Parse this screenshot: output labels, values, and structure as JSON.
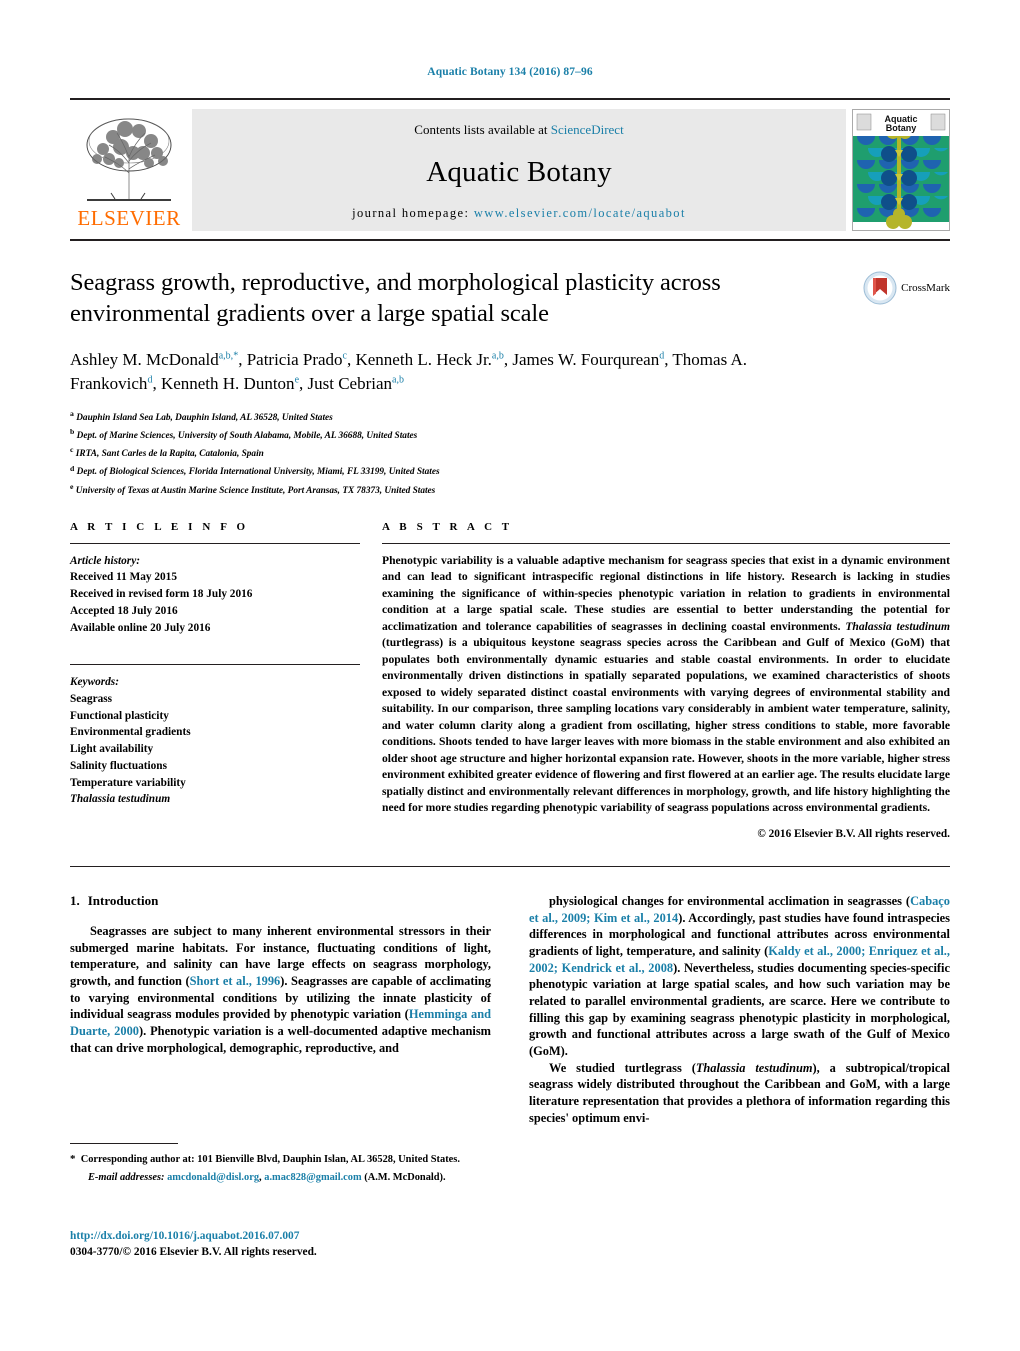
{
  "running_head": "Aquatic Botany 134 (2016) 87–96",
  "masthead": {
    "publisher": "ELSEVIER",
    "contents_prefix": "Contents lists available at ",
    "contents_link": "ScienceDirect",
    "journal_name": "Aquatic Botany",
    "homepage_prefix": "journal homepage: ",
    "homepage_url": "www.elsevier.com/locate/aquabot",
    "cover_title_line1": "Aquatic",
    "cover_title_line2": "Botany",
    "accent_color": "#1a7fa8",
    "elsevier_orange": "#ff6c00"
  },
  "crossmark": {
    "label": "CrossMark"
  },
  "title": "Seagrass growth, reproductive, and morphological plasticity across environmental gradients over a large spatial scale",
  "authors_html": "Ashley M. McDonald<sup>a,b,</sup><sup>*</sup>, Patricia Prado<sup>c</sup>, Kenneth L. Heck Jr.<sup>a,b</sup>, James W. Fourqurean<sup>d</sup>, Thomas A. Frankovich<sup>d</sup>, Kenneth H. Dunton<sup>e</sup>, Just Cebrian<sup>a,b</sup>",
  "affiliations": [
    {
      "mark": "a",
      "text": "Dauphin Island Sea Lab, Dauphin Island, AL 36528, United States"
    },
    {
      "mark": "b",
      "text": "Dept. of Marine Sciences, University of South Alabama, Mobile, AL 36688, United States"
    },
    {
      "mark": "c",
      "text": "IRTA, Sant Carles de la Rapita, Catalonia, Spain"
    },
    {
      "mark": "d",
      "text": "Dept. of Biological Sciences, Florida International University, Miami, FL 33199, United States"
    },
    {
      "mark": "e",
      "text": "University of Texas at Austin Marine Science Institute, Port Aransas, TX 78373, United States"
    }
  ],
  "article_info": {
    "heading": "A R T I C L E   I N F O",
    "history_label": "Article history:",
    "history": [
      "Received 11 May 2015",
      "Received in revised form 18 July 2016",
      "Accepted 18 July 2016",
      "Available online 20 July 2016"
    ],
    "keywords_label": "Keywords:",
    "keywords": [
      "Seagrass",
      "Functional plasticity",
      "Environmental gradients",
      "Light availability",
      "Salinity fluctuations",
      "Temperature variability",
      "Thalassia testudinum"
    ],
    "keywords_italic_index": 6
  },
  "abstract": {
    "heading": "A B S T R A C T",
    "paragraph_html": "Phenotypic variability is a valuable adaptive mechanism for seagrass species that exist in a dynamic environment and can lead to significant intraspecific regional distinctions in life history. Research is lacking in studies examining the significance of within-species phenotypic variation in relation to gradients in environmental condition at a large spatial scale. These studies are essential to better understanding the potential for acclimatization and tolerance capabilities of seagrasses in declining coastal environments. <span class=\"ital\">Thalassia testudinum</span> (turtlegrass) is a ubiquitous keystone seagrass species across the Caribbean and Gulf of Mexico (GoM) that populates both environmentally dynamic estuaries and stable coastal environments. In order to elucidate environmentally driven distinctions in spatially separated populations, we examined characteristics of shoots exposed to widely separated distinct coastal environments with varying degrees of environmental stability and suitability. In our comparison, three sampling locations vary considerably in ambient water temperature, salinity, and water column clarity along a gradient from oscillating, higher stress conditions to stable, more favorable conditions. Shoots tended to have larger leaves with more biomass in the stable environment and also exhibited an older shoot age structure and higher horizontal expansion rate. However, shoots in the more variable, higher stress environment exhibited greater evidence of flowering and first flowered at an earlier age. The results elucidate large spatially distinct and environmentally relevant differences in morphology, growth, and life history highlighting the need for more studies regarding phenotypic variability of seagrass populations across environmental gradients.",
    "copyright": "© 2016 Elsevier B.V. All rights reserved."
  },
  "body": {
    "section_number": "1.",
    "section_title": "Introduction",
    "left_paragraph_html": "Seagrasses are subject to many inherent environmental stressors in their submerged marine habitats. For instance, fluctuating conditions of light, temperature, and salinity can have large effects on seagrass morphology, growth, and function (<span class=\"ref\">Short et al., 1996</span>). Seagrasses are capable of acclimating to varying environmental conditions by utilizing the innate plasticity of individual seagrass modules provided by phenotypic variation (<span class=\"ref\">Hemminga and Duarte, 2000</span>). Phenotypic variation is a well-documented adaptive mechanism that can drive morphological, demographic, reproductive, and",
    "right_paragraph1_html": "physiological changes for environmental acclimation in seagrasses (<span class=\"ref\">Cabaço et al., 2009; Kim et al., 2014</span>). Accordingly, past studies have found intraspecies differences in morphological and functional attributes across environmental gradients of light, temperature, and salinity (<span class=\"ref\">Kaldy et al., 2000; Enriquez et al., 2002; Kendrick et al., 2008</span>). Nevertheless, studies documenting species-specific phenotypic variation at large spatial scales, and how such variation may be related to parallel environmental gradients, are scarce. Here we contribute to filling this gap by examining seagrass phenotypic plasticity in morphological, growth and functional attributes across a large swath of the Gulf of Mexico (GoM).",
    "right_paragraph2_html": "We studied turtlegrass (<span class=\"ital\">Thalassia testudinum</span>), a subtropical/tropical seagrass widely distributed throughout the Caribbean and GoM, with a large literature representation that provides a plethora of information regarding this species' optimum envi-"
  },
  "footnote": {
    "corresponding_html": "<span class=\"star\">*</span>&nbsp; Corresponding author at: 101 Bienville Blvd, Dauphin Islan, AL 36528, United States.",
    "email_html": "<span class=\"em\">E-mail addresses:</span> <span class=\"mail\">amcdonald@disl.org</span>, <span class=\"mail\">a.mac828@gmail.com</span> (A.M. McDonald)."
  },
  "doi_line": "http://dx.doi.org/10.1016/j.aquabot.2016.07.007",
  "issn_line": "0304-3770/© 2016 Elsevier B.V. All rights reserved."
}
